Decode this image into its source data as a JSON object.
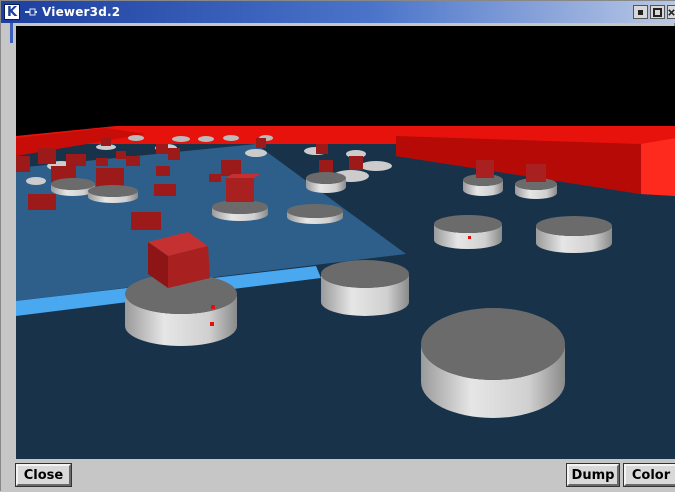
{
  "window": {
    "title": "Viewer3d.2",
    "app_icon": "kde-k-icon",
    "pin_icon": "pin-icon",
    "controls": [
      "minimize-icon",
      "maximize-icon",
      "close-icon"
    ]
  },
  "toolbar": {
    "close_label": "Close",
    "dump_label": "Dump",
    "color_label": "Color"
  },
  "scene": {
    "background_color": "#000000",
    "floor_color": "#18324a",
    "lit_plane_color": "#2d5f8a",
    "edge_strip_color": "#4aa8f0",
    "wall_color": "#e8120c",
    "cylinder_top_color": "#6b6b6b",
    "cylinder_side_color": "#d6d6d6",
    "cube_color": "#a82020"
  }
}
